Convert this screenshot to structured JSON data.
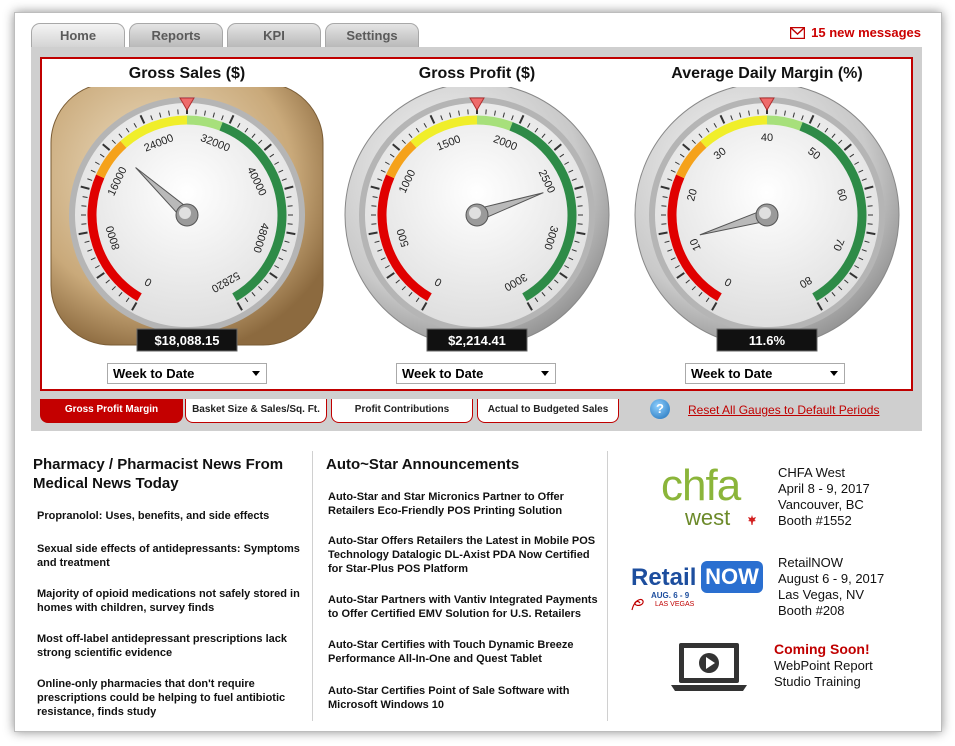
{
  "tabs": [
    {
      "label": "Home",
      "active": true
    },
    {
      "label": "Reports",
      "active": false
    },
    {
      "label": "KPI",
      "active": false
    },
    {
      "label": "Settings",
      "active": false
    }
  ],
  "messages": {
    "label": "15 new messages",
    "icon": "envelope-icon"
  },
  "gauges": [
    {
      "title": "Gross Sales ($)",
      "scale_labels": [
        "0",
        "8000",
        "16000",
        "24000",
        "32000",
        "40000",
        "48000",
        "52820"
      ],
      "min": 0,
      "max": 52820,
      "value": 18088.15,
      "readout": "$18,088.15",
      "period": "Week to Date",
      "bezel": "bronze"
    },
    {
      "title": "Gross Profit ($)",
      "scale_labels": [
        "0",
        "500",
        "1000",
        "1500",
        "2000",
        "2500",
        "3000",
        "3000"
      ],
      "min": 0,
      "max": 3000,
      "value": 2214.41,
      "readout": "$2,214.41",
      "period": "Week to Date",
      "bezel": "silver"
    },
    {
      "title": "Average Daily Margin (%)",
      "scale_labels": [
        "0",
        "10",
        "20",
        "30",
        "40",
        "50",
        "60",
        "70",
        "80"
      ],
      "min": 0,
      "max": 80,
      "value": 11.6,
      "readout": "11.6%",
      "period": "Week to Date",
      "bezel": "silver"
    }
  ],
  "bottom_tabs": [
    {
      "label": "Gross Profit Margin",
      "active": true
    },
    {
      "label": "Basket Size & Sales/Sq. Ft.",
      "active": false
    },
    {
      "label": "Profit Contributions",
      "active": false
    },
    {
      "label": "Actual to Budgeted Sales",
      "active": false
    }
  ],
  "reset_link": "Reset All Gauges to Default Periods",
  "news": {
    "title": "Pharmacy / Pharmacist News From Medical News Today",
    "items": [
      "Propranolol: Uses, benefits, and side effects",
      "Sexual side effects of antidepressants: Symptoms and treatment",
      "Majority of opioid medications not safely stored in homes with children, survey finds",
      "Most off-label antidepressant prescriptions lack strong scientific evidence",
      "Online-only pharmacies that don't require prescriptions could be helping to fuel antibiotic resistance, finds study"
    ]
  },
  "announcements": {
    "title": "Auto~Star Announcements",
    "items": [
      "Auto-Star and Star Micronics Partner to Offer Retailers Eco-Friendly POS Printing Solution",
      "Auto-Star Offers Retailers the Latest in Mobile POS Technology Datalogic DL-Axist PDA Now Certified for Star-Plus POS Platform",
      "Auto-Star Partners with Vantiv Integrated Payments to Offer Certified EMV Solution for U.S. Retailers",
      "Auto-Star Certifies with Touch Dynamic Breeze Performance All-In-One and Quest Tablet",
      "Auto-Star Certifies Point of Sale Software with Microsoft Windows 10"
    ]
  },
  "events": [
    {
      "logo": {
        "main": "chfa",
        "sub": "west"
      },
      "lines": [
        "CHFA West",
        "April 8 - 9, 2017",
        "Vancouver, BC",
        "Booth #1552"
      ]
    },
    {
      "logo": {
        "main": "Retail",
        "badge": "NOW",
        "tag": "AUG. 6 - 9",
        "tag2": "LAS VEGAS"
      },
      "lines": [
        "RetailNOW",
        "August 6 - 9, 2017",
        "Las Vegas, NV",
        "Booth #208"
      ]
    },
    {
      "logo": {
        "icon": "video-laptop-icon"
      },
      "headline": "Coming Soon!",
      "lines": [
        "WebPoint Report",
        "Studio Training"
      ]
    }
  ],
  "colors": {
    "accent": "#c00000",
    "zone_red": "#e00000",
    "zone_orange": "#f5a21b",
    "zone_yellow": "#f0ee2a",
    "zone_lightgreen": "#a7e07b",
    "zone_green": "#2e8b47",
    "chfa_green": "#8bb53a",
    "retail_blue": "#1d4e9e"
  }
}
